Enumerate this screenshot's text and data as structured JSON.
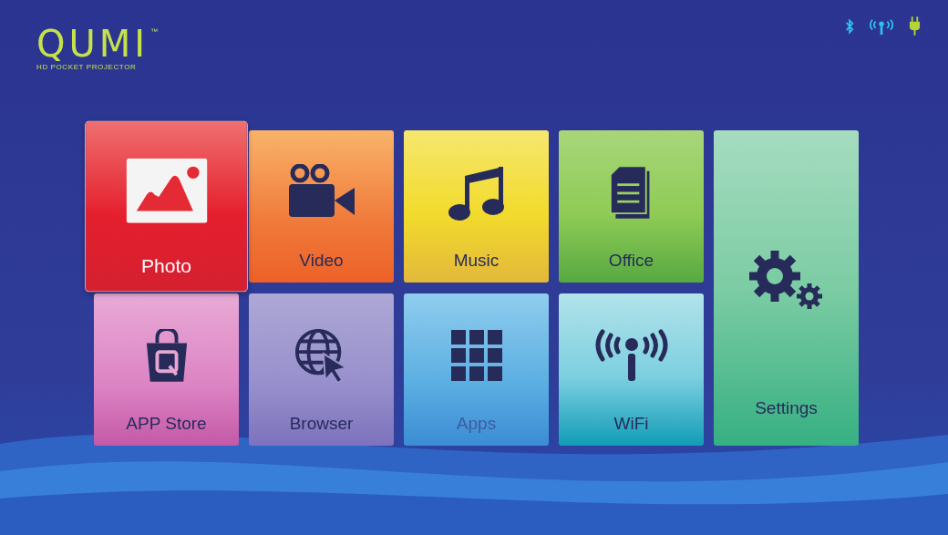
{
  "logo": {
    "name": "QUMI",
    "trademark": "™",
    "tagline": "HD POCKET PROJECTOR"
  },
  "status_icons": [
    {
      "kind": "bluetooth"
    },
    {
      "kind": "signal"
    },
    {
      "kind": "power"
    }
  ],
  "tiles": [
    {
      "label": "Photo",
      "kind": "photo",
      "selected": true
    },
    {
      "label": "Video",
      "kind": "video",
      "selected": false
    },
    {
      "label": "Music",
      "kind": "music",
      "selected": false
    },
    {
      "label": "Office",
      "kind": "office",
      "selected": false
    },
    {
      "label": "Settings",
      "kind": "settings",
      "selected": false
    },
    {
      "label": "APP Store",
      "kind": "store",
      "selected": false
    },
    {
      "label": "Browser",
      "kind": "browser",
      "selected": false
    },
    {
      "label": "Apps",
      "kind": "apps",
      "selected": false
    },
    {
      "label": "WiFi",
      "kind": "wifi",
      "selected": false
    }
  ]
}
